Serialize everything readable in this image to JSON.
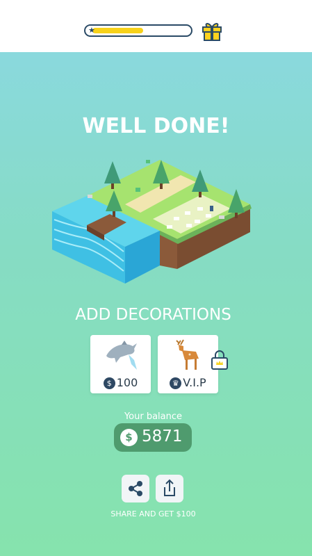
{
  "header": {
    "level_progress": 0.5,
    "star_icon": "star-icon",
    "gift_icon": "gift-icon"
  },
  "main": {
    "title": "WELL DONE!",
    "subtitle": "ADD DECORATIONS",
    "decorations": [
      {
        "icon": "dolphin-icon",
        "price_icon": "coin-icon",
        "price": "100"
      },
      {
        "icon": "deer-icon",
        "price_icon": "crown-icon",
        "price": "V.I.P",
        "locked": true
      }
    ],
    "balance": {
      "label": "Your balance",
      "currency_symbol": "$",
      "value": "5871"
    },
    "share": {
      "buttons": [
        "share-icon",
        "export-icon"
      ],
      "label": "SHARE AND GET $100"
    }
  },
  "colors": {
    "accent_yellow": "#f7d21a",
    "dark_navy": "#2a4a66",
    "balance_green": "#4f9b6e",
    "bg_top": "#8bd8e4",
    "bg_bottom": "#86e3ad"
  }
}
